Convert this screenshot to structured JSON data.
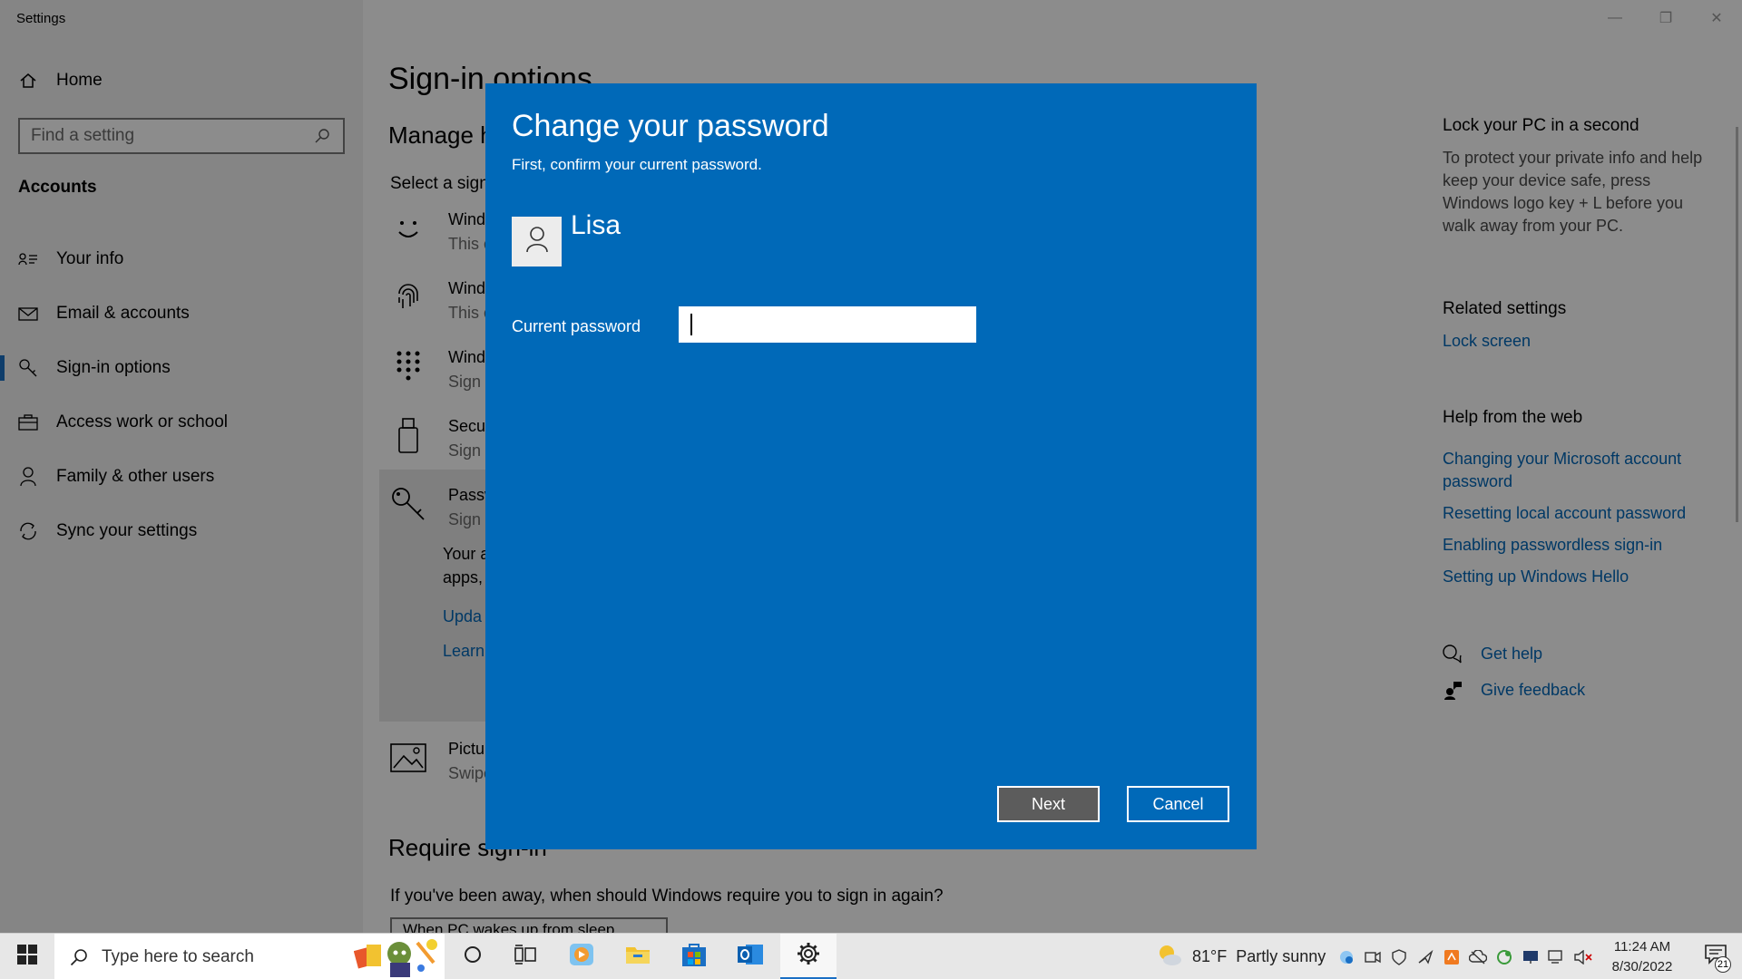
{
  "window": {
    "title": "Settings"
  },
  "sidebar": {
    "home_label": "Home",
    "search_placeholder": "Find a setting",
    "section": "Accounts",
    "items": [
      {
        "label": "Your info",
        "icon": "contact-card-icon"
      },
      {
        "label": "Email & accounts",
        "icon": "mail-icon"
      },
      {
        "label": "Sign-in options",
        "icon": "key-icon",
        "active": true
      },
      {
        "label": "Access work or school",
        "icon": "briefcase-icon"
      },
      {
        "label": "Family & other users",
        "icon": "person-icon"
      },
      {
        "label": "Sync your settings",
        "icon": "sync-icon"
      }
    ]
  },
  "main": {
    "title": "Sign-in options",
    "manage_heading": "Manage h",
    "select_text": "Select a sign",
    "options": [
      {
        "t1": "Windo",
        "t2": "This o"
      },
      {
        "t1": "Windo",
        "t2": "This o"
      },
      {
        "t1": "Windo",
        "t2": "Sign i"
      },
      {
        "t1": "Secur",
        "t2": "Sign i"
      },
      {
        "t1": "Passw",
        "t2": "Sign i"
      },
      {
        "t1": "Pictur",
        "t2": "Swipe"
      }
    ],
    "password_desc_1": "Your a",
    "password_desc_2": "apps,",
    "password_link_update": "Upda",
    "password_link_learn": "Learn",
    "require_heading": "Require sign-in",
    "require_text": "If you've been away, when should Windows require you to sign in again?",
    "require_value": "When PC wakes up from sleep"
  },
  "right_col": {
    "lock_heading": "Lock your PC in a second",
    "lock_text": "To protect your private info and help keep your device safe, press Windows logo key + L before you walk away from your PC.",
    "related_heading": "Related settings",
    "related_link": "Lock screen",
    "web_heading": "Help from the web",
    "web_links": [
      "Changing your Microsoft account password",
      "Resetting local account password",
      "Enabling passwordless sign-in",
      "Setting up Windows Hello"
    ],
    "get_help": "Get help",
    "give_feedback": "Give feedback"
  },
  "dialog": {
    "title": "Change your password",
    "subtitle": "First, confirm your current password.",
    "username": "Lisa",
    "field_label": "Current password",
    "field_value": "",
    "next_label": "Next",
    "cancel_label": "Cancel",
    "bg_color": "#0069b8"
  },
  "taskbar": {
    "search_placeholder": "Type here to search",
    "weather_temp": "81°F",
    "weather_desc": "Partly sunny",
    "time": "11:24 AM",
    "date": "8/30/2022",
    "notification_count": "21"
  }
}
